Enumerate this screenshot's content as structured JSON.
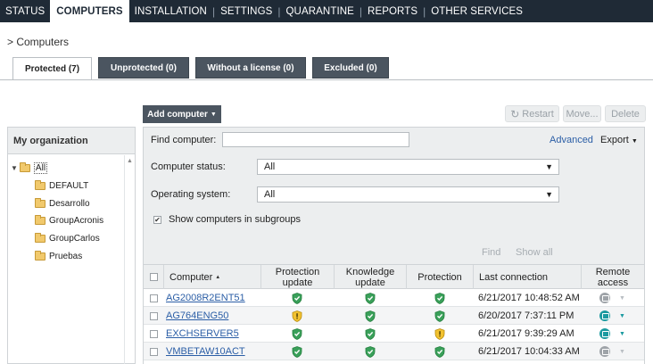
{
  "nav": {
    "items": [
      {
        "label": "STATUS",
        "active": false
      },
      {
        "label": "COMPUTERS",
        "active": true
      },
      {
        "label": "INSTALLATION",
        "active": false
      },
      {
        "label": "SETTINGS",
        "active": false
      },
      {
        "label": "QUARANTINE",
        "active": false
      },
      {
        "label": "REPORTS",
        "active": false
      },
      {
        "label": "OTHER SERVICES",
        "active": false
      }
    ],
    "separator": "|"
  },
  "breadcrumb": "> Computers",
  "tabs": [
    {
      "label": "Protected (7)",
      "active": true
    },
    {
      "label": "Unprotected (0)",
      "active": false
    },
    {
      "label": "Without a license (0)",
      "active": false
    },
    {
      "label": "Excluded (0)",
      "active": false
    }
  ],
  "toolbar": {
    "add_computer": "Add computer",
    "restart": "Restart",
    "move": "Move...",
    "delete": "Delete"
  },
  "org": {
    "header": "My organization",
    "root": "All",
    "groups": [
      "DEFAULT",
      "Desarrollo",
      "GroupAcronis",
      "GroupCarlos",
      "Pruebas"
    ]
  },
  "filters": {
    "find_computer_label": "Find computer:",
    "find_computer_value": "",
    "advanced": "Advanced",
    "export": "Export",
    "status_label": "Computer status:",
    "status_value": "All",
    "os_label": "Operating system:",
    "os_value": "All",
    "subgroups_label": "Show computers in subgroups",
    "subgroups_checked": true,
    "find": "Find",
    "show_all": "Show all"
  },
  "table": {
    "headers": {
      "computer": "Computer",
      "protection_update_1": "Protection",
      "protection_update_2": "update",
      "knowledge_update_1": "Knowledge",
      "knowledge_update_2": "update",
      "protection": "Protection",
      "last_connection": "Last connection",
      "remote_access_1": "Remote",
      "remote_access_2": "access"
    },
    "rows": [
      {
        "name": "AG2008R2ENT51",
        "protection_update": "ok",
        "knowledge_update": "ok",
        "protection": "ok",
        "last_connection": "6/21/2017 10:48:52 AM",
        "remote": "inactive"
      },
      {
        "name": "AG764ENG50",
        "protection_update": "warning",
        "knowledge_update": "ok",
        "protection": "ok",
        "last_connection": "6/20/2017 7:37:11 PM",
        "remote": "active"
      },
      {
        "name": "EXCHSERVER5",
        "protection_update": "ok",
        "knowledge_update": "ok",
        "protection": "warning",
        "last_connection": "6/21/2017 9:39:29 AM",
        "remote": "active"
      },
      {
        "name": "VMBETAW10ACT",
        "protection_update": "ok",
        "knowledge_update": "ok",
        "protection": "ok",
        "last_connection": "6/21/2017 10:04:33 AM",
        "remote": "inactive"
      }
    ]
  },
  "colors": {
    "nav_bg": "#1f2a36",
    "ok_green": "#3aa05a",
    "warning_yellow": "#f2c230",
    "remote_active": "#1b9aa0",
    "remote_inactive": "#9ea3a8",
    "link_blue": "#2b5ea6"
  }
}
